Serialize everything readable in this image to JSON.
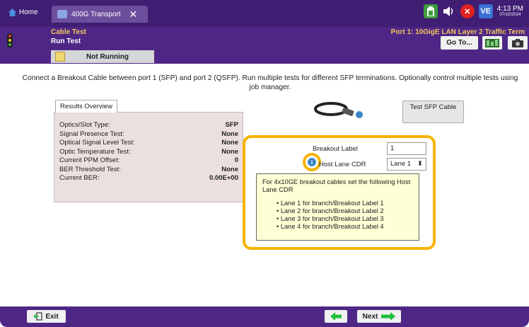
{
  "system": {
    "home_label": "Home",
    "tab_label": "400G Transport",
    "tab_close": "✕",
    "time": "4:13 PM",
    "date": "07/10/2024",
    "vnc_badge": "VE"
  },
  "header": {
    "breadcrumb_1": "Cable Test",
    "breadcrumb_2": "Run Test",
    "port_title": "Port 1: 10GigE LAN Layer 2 Traffic Term",
    "goto_label": "Go To...",
    "status_text": "Not Running"
  },
  "intro_text": "Connect a Breakout Cable between port 1 (SFP) and port 2 (QSFP). Run multiple tests for different SFP terminations. Optionally control multiple tests using job manager.",
  "results": {
    "tab_label": "Results Overview",
    "rows": [
      {
        "label": "Optics/Slot Type:",
        "value": "SFP"
      },
      {
        "label": "Signal Presence Test:",
        "value": "None"
      },
      {
        "label": "Optical Signal Level Test:",
        "value": "None"
      },
      {
        "label": "Optic Temperature Test:",
        "value": "None"
      },
      {
        "label": "Current PPM Offset:",
        "value": "0"
      },
      {
        "label": "BER Threshold Test:",
        "value": "None"
      },
      {
        "label": "Current BER:",
        "value": "0.00E+00"
      }
    ]
  },
  "test_sfp_button": "Test SFP Cable",
  "breakout": {
    "label": "Breakout Label",
    "value": "1"
  },
  "host_lane": {
    "label": "Host Lane CDR",
    "selected": "Lane 1"
  },
  "tooltip": {
    "heading": "For 4x10GE breakout cables set the following Host Lane CDR",
    "items": [
      "Lane 1 for branch/Breakout Label 1",
      "Lane 2 for branch/Breakout Label 2",
      "Lane 3 for branch/Breakout Label 3",
      "Lane 4 for branch/Breakout Label 4"
    ]
  },
  "footer": {
    "exit_label": "Exit",
    "next_label": "Next"
  },
  "colors": {
    "header_purple": "#4e2786",
    "highlight": "#f6b400",
    "accent_yellow": "#f4c65a",
    "arrow_green": "#1fbf3a"
  }
}
